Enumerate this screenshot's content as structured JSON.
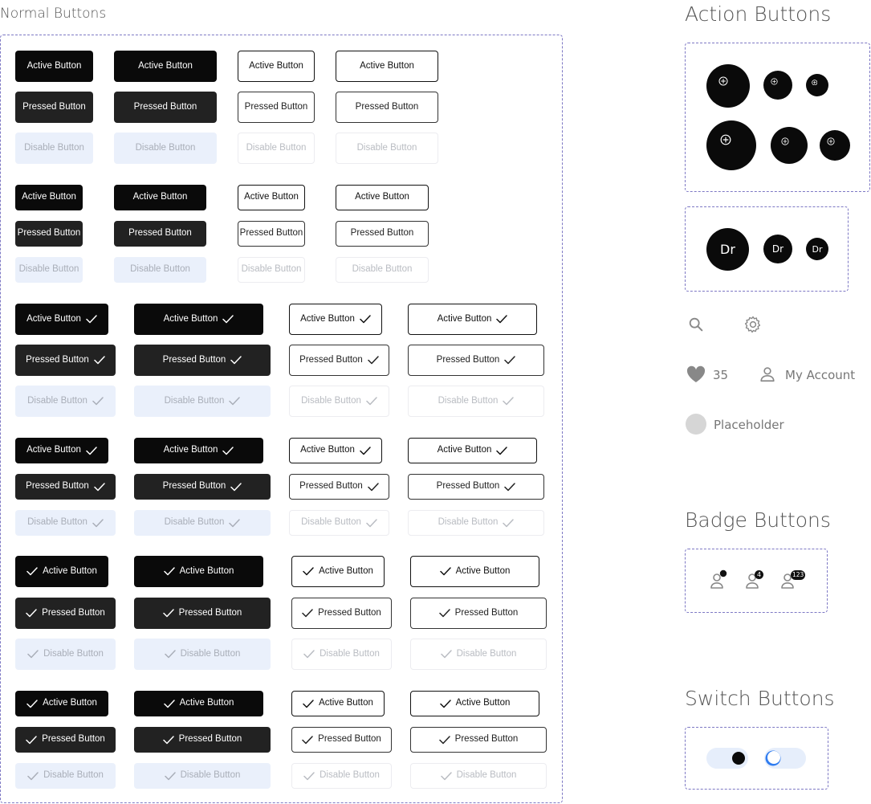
{
  "sections": {
    "normal": "Normal Buttons",
    "action": "Action Buttons",
    "badge": "Badge Buttons",
    "switch": "Switch Buttons"
  },
  "buttons": {
    "active": "Active Button",
    "pressed": "Pressed Button",
    "disable": "Disable Button"
  },
  "avatar_initials": "Dr",
  "links": {
    "likes_count": "35",
    "account": "My Account",
    "placeholder": "Placeholder"
  },
  "badges": {
    "count_small": "4",
    "count_large": "123"
  },
  "switches": [
    {
      "state": "on"
    },
    {
      "state": "off"
    }
  ],
  "colors": {
    "primary": "#0a0a0a",
    "pressed": "#222222",
    "disabled_fill": "#eaf0fb",
    "frame_border": "#7d78c4",
    "switch_off_knob": "#2f7cf0"
  }
}
